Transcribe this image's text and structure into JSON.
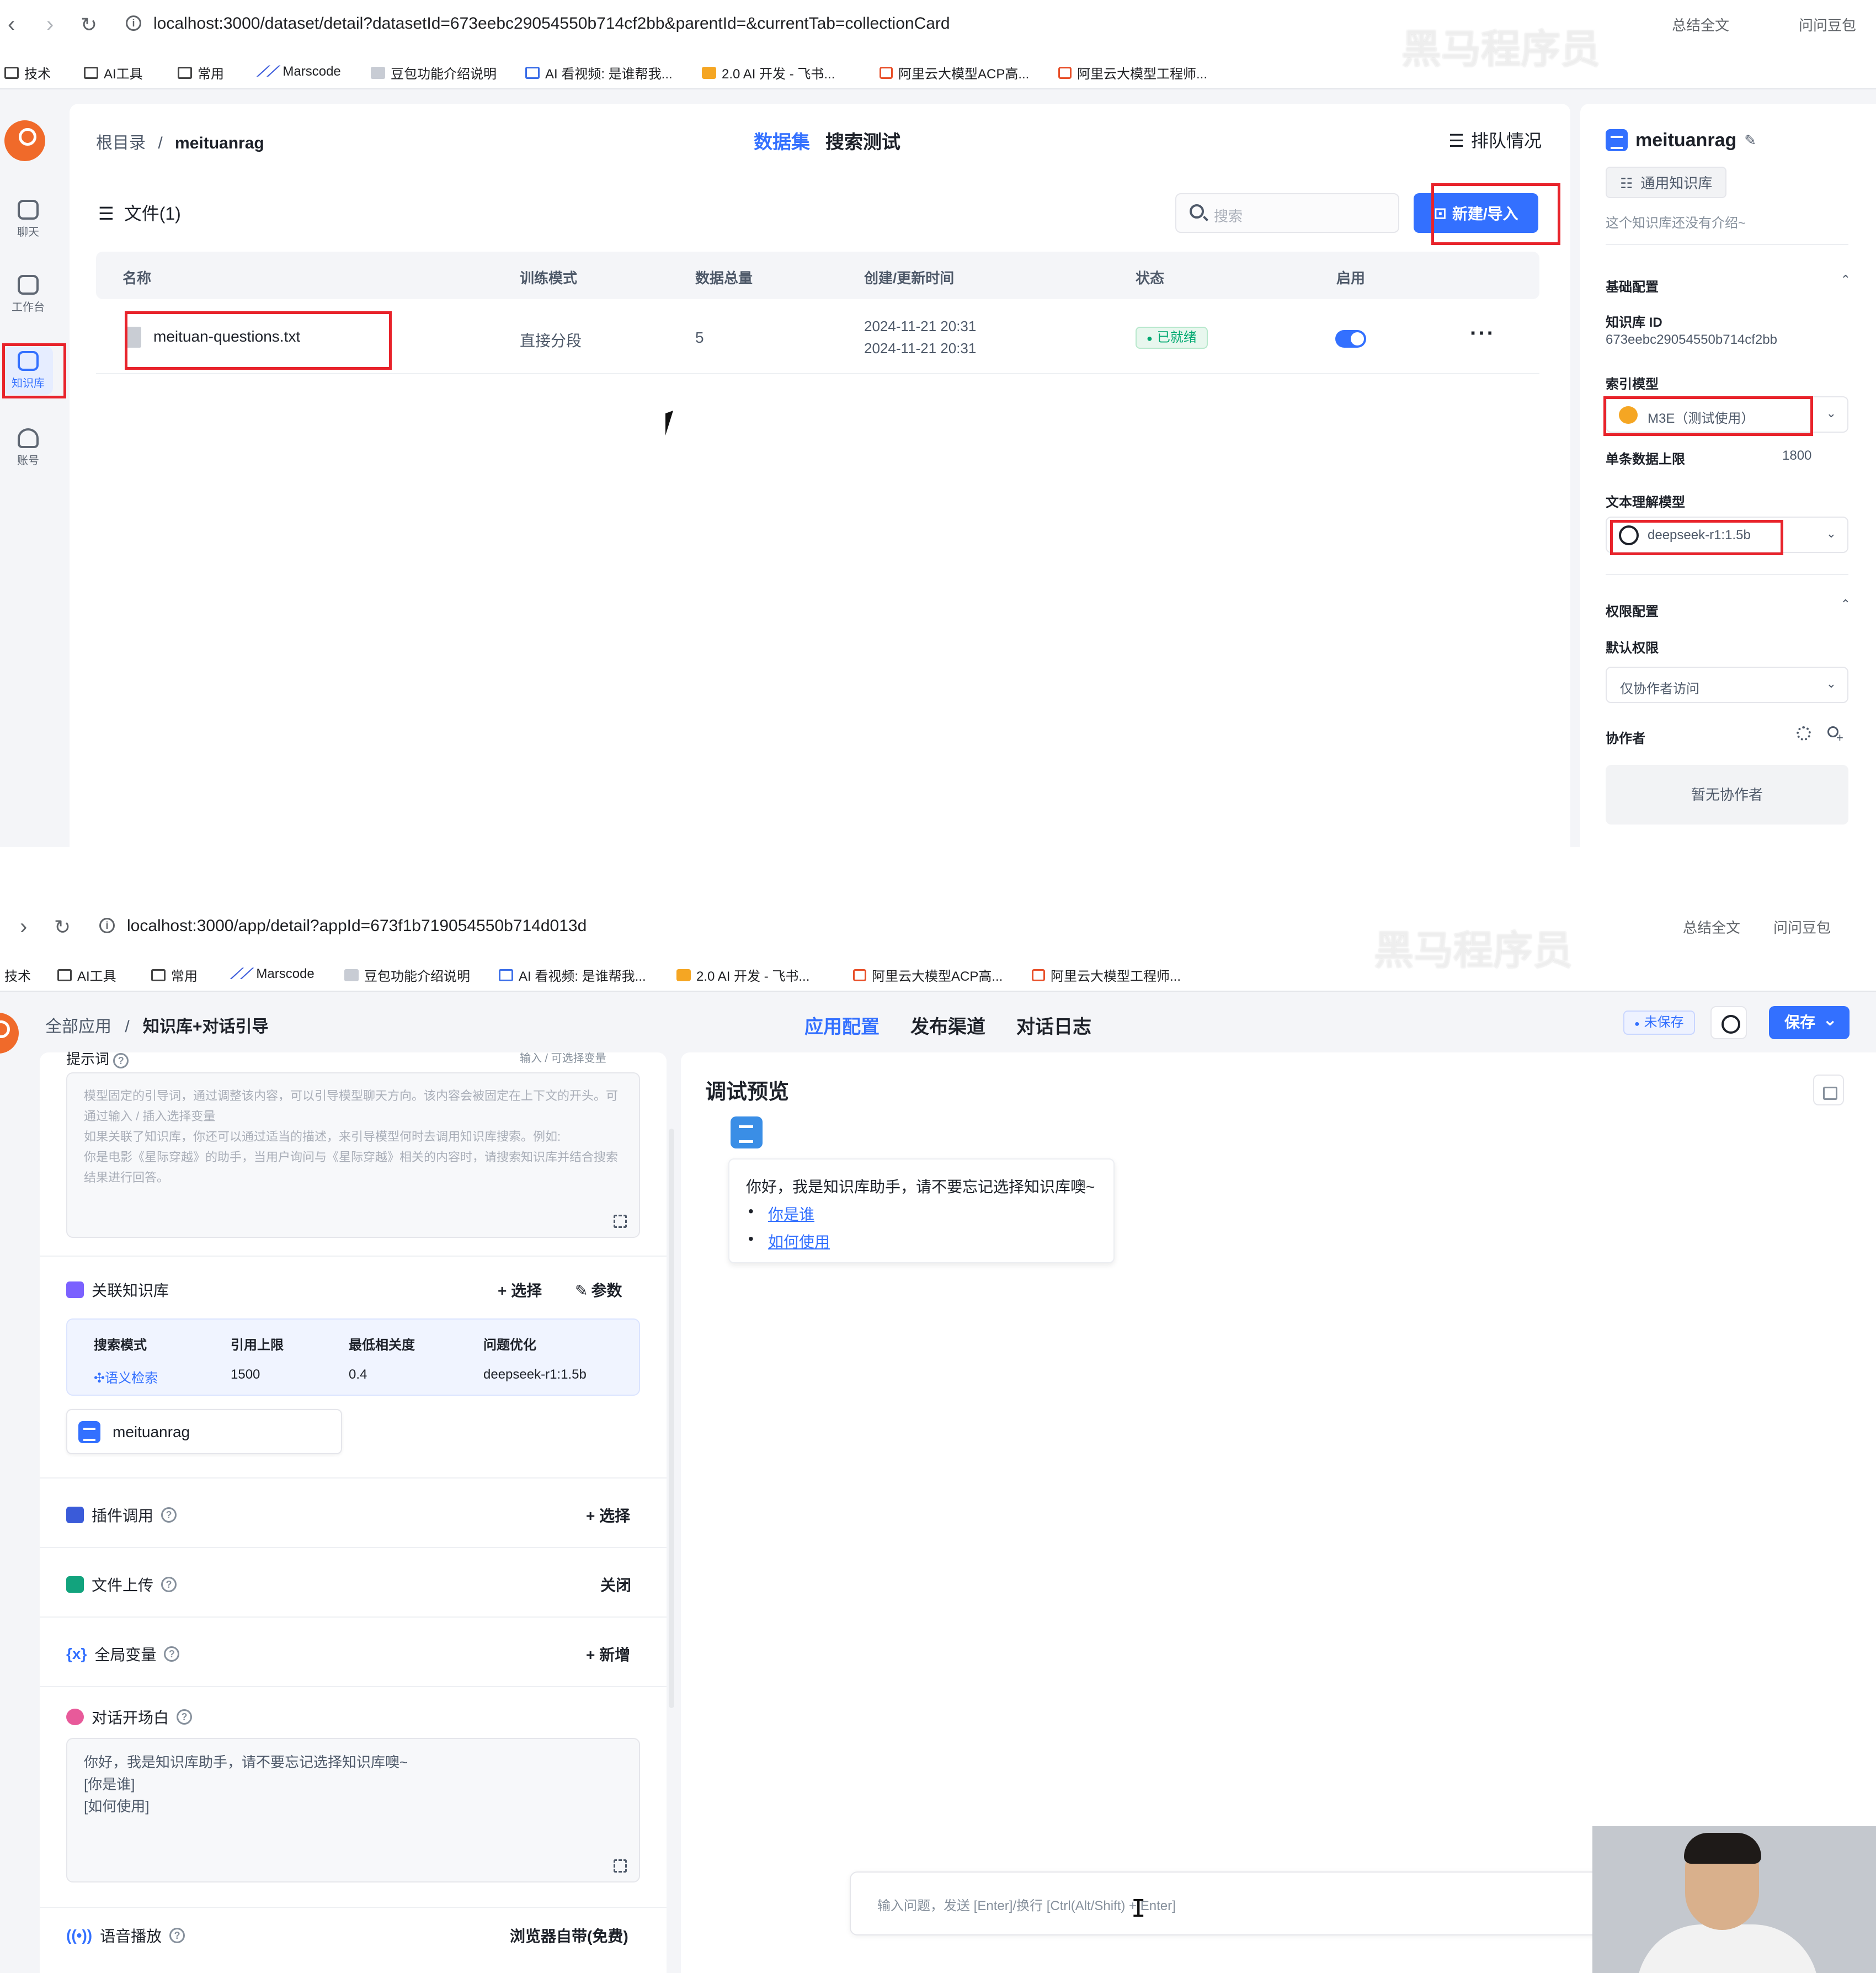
{
  "shot1": {
    "url": "localhost:3000/dataset/detail?datasetId=673eebc29054550b714cf2bb&parentId=&currentTab=collectionCard",
    "chrome_right": [
      "总结全文",
      "问问豆包"
    ],
    "bookmarks": [
      "技术",
      "AI工具",
      "常用",
      "Marscode",
      "豆包功能介绍说明",
      "AI 看视频: 是谁帮我...",
      "2.0 AI 开发 - 飞书...",
      "阿里云大模型ACP高...",
      "阿里云大模型工程师..."
    ],
    "sidebar": [
      {
        "label": "聊天",
        "icon": "chat-icon"
      },
      {
        "label": "工作台",
        "icon": "robot-icon"
      },
      {
        "label": "知识库",
        "icon": "database-icon",
        "active": true
      },
      {
        "label": "账号",
        "icon": "user-icon"
      }
    ],
    "breadcrumb": {
      "root": "根目录",
      "sep": "/",
      "current": "meituanrag"
    },
    "tabs": [
      {
        "label": "数据集",
        "active": true
      },
      {
        "label": "搜索测试",
        "active": false
      }
    ],
    "queue_label": "排队情况",
    "files_title": "文件(1)",
    "search_placeholder": "搜索",
    "new_import_label": "新建/导入",
    "table": {
      "headers": [
        "名称",
        "训练模式",
        "数据总量",
        "创建/更新时间",
        "状态",
        "启用"
      ],
      "rows": [
        {
          "name": "meituan-questions.txt",
          "mode": "直接分段",
          "count": "5",
          "created": "2024-11-21 20:31",
          "updated": "2024-11-21 20:31",
          "status": "已就绪",
          "enabled": true,
          "more": "···"
        }
      ]
    },
    "panel": {
      "title": "meituanrag",
      "type_chip": "通用知识库",
      "intro": "这个知识库还没有介绍~",
      "basic_config": "基础配置",
      "kb_id_label": "知识库 ID",
      "kb_id": "673eebc29054550b714cf2bb",
      "index_model_label": "索引模型",
      "index_model": "M3E（测试使用）",
      "max_chunk_label": "单条数据上限",
      "max_chunk": "1800",
      "text_model_label": "文本理解模型",
      "text_model": "deepseek-r1:1.5b",
      "perm_config": "权限配置",
      "default_perm_label": "默认权限",
      "default_perm": "仅协作者访问",
      "collab_label": "协作者",
      "collab_empty": "暂无协作者"
    },
    "watermark": "黑马程序员"
  },
  "shot2": {
    "url": "localhost:3000/app/detail?appId=673f1b719054550b714d013d",
    "chrome_right": [
      "总结全文",
      "问问豆包"
    ],
    "bookmarks": [
      "技术",
      "AI工具",
      "常用",
      "Marscode",
      "豆包功能介绍说明",
      "AI 看视频: 是谁帮我...",
      "2.0 AI 开发 - 飞书...",
      "阿里云大模型ACP高...",
      "阿里云大模型工程师..."
    ],
    "breadcrumb": {
      "root": "全部应用",
      "sep": "/",
      "current": "知识库+对话引导"
    },
    "tabs": [
      {
        "label": "应用配置",
        "active": true
      },
      {
        "label": "发布渠道",
        "active": false
      },
      {
        "label": "对话日志",
        "active": false
      }
    ],
    "unsaved": "未保存",
    "save": "保存",
    "prompt": {
      "label": "提示词",
      "hint": "输入 / 可选择变量",
      "placeholder": "模型固定的引导词，通过调整该内容，可以引导模型聊天方向。该内容会被固定在上下文的开头。可通过输入 / 插入选择变量\n如果关联了知识库，你还可以通过适当的描述，来引导模型何时去调用知识库搜索。例如:\n你是电影《星际穿越》的助手，当用户询问与《星际穿越》相关的内容时，请搜索知识库并结合搜索结果进行回答。"
    },
    "kb_section": {
      "title": "关联知识库",
      "select": "+ 选择",
      "params": "参数",
      "headers": [
        "搜索模式",
        "引用上限",
        "最低相关度",
        "问题优化"
      ],
      "values": [
        "语义检索",
        "1500",
        "0.4",
        "deepseek-r1:1.5b"
      ],
      "kb_name": "meituanrag"
    },
    "plugin": {
      "title": "插件调用",
      "action": "+ 选择"
    },
    "file_upload": {
      "title": "文件上传",
      "action": "关闭"
    },
    "global_vars": {
      "title": "全局变量",
      "action": "+ 新增"
    },
    "opening": {
      "title": "对话开场白",
      "text": "你好，我是知识库助手，请不要忘记选择知识库噢~\n[你是谁]\n[如何使用]"
    },
    "tts": {
      "title": "语音播放",
      "action": "浏览器自带(免费)"
    },
    "preview": {
      "title": "调试预览",
      "greeting": "你好，我是知识库助手，请不要忘记选择知识库噢~",
      "questions": [
        "你是谁",
        "如何使用"
      ],
      "input_placeholder": "输入问题，发送 [Enter]/换行 [Ctrl(Alt/Shift) + Enter]"
    },
    "watermark": "黑马程序员"
  },
  "colors": {
    "accent": "#3370ff",
    "highlight": "#e8232b",
    "success": "#00a870"
  }
}
